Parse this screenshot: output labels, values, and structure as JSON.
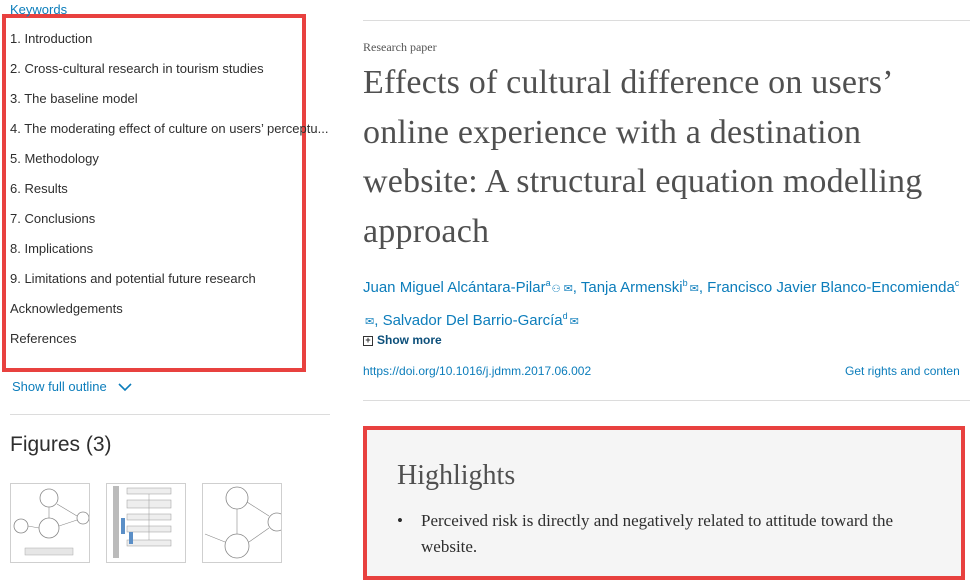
{
  "outline": {
    "items": [
      "Keywords",
      "1. Introduction",
      "2. Cross-cultural research in tourism studies",
      "3. The baseline model",
      "4. The moderating effect of culture on users’ perceptu...",
      "5. Methodology",
      "6. Results",
      "7. Conclusions",
      "8. Implications",
      "9. Limitations and potential future research",
      "Acknowledgements",
      "References"
    ],
    "show_full": "Show full outline"
  },
  "figures": {
    "title": "Figures (3)",
    "thumbnail_icons": [
      "path-diagram-thumbnail",
      "flowchart-thumbnail",
      "structural-model-thumbnail"
    ]
  },
  "article": {
    "type": "Research paper",
    "title": "Effects of cultural difference on users’ online experience with a destination website: A structural equation modelling approach",
    "authors": [
      {
        "name": "Juan Miguel Alcántara-Pilar",
        "sup": "a"
      },
      {
        "name": "Tanja Armenski",
        "sup": "b"
      },
      {
        "name": "Francisco Javier Blanco-Encomienda",
        "sup": "c"
      },
      {
        "name": "Salvador Del Barrio-García",
        "sup": "d"
      }
    ],
    "show_more": "Show more",
    "doi": "https://doi.org/10.1016/j.jdmm.2017.06.002",
    "rights": "Get rights and conten"
  },
  "highlights": {
    "title": "Highlights",
    "items": [
      "Perceived risk is directly and negatively related to attitude toward the website."
    ]
  },
  "colors": {
    "link": "#0c7dbb",
    "annotation_red": "#e8413f",
    "title_gray": "#505050",
    "highlight_bg": "#f5f5f5"
  }
}
